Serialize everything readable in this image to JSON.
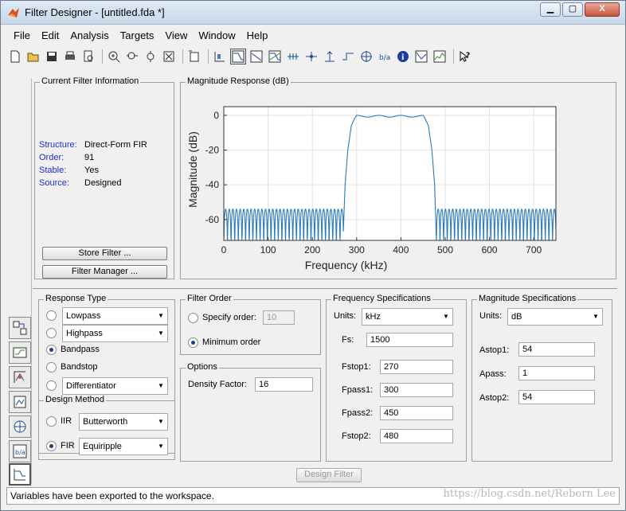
{
  "window": {
    "title": "Filter Designer -  [untitled.fda *]",
    "minimize_label": "▁",
    "maximize_label": "▢",
    "close_label": "X"
  },
  "menu": [
    {
      "label": "File"
    },
    {
      "label": "Edit"
    },
    {
      "label": "Analysis"
    },
    {
      "label": "Targets"
    },
    {
      "label": "View"
    },
    {
      "label": "Window"
    },
    {
      "label": "Help"
    }
  ],
  "current_filter": {
    "title": "Current Filter Information",
    "structure_label": "Structure:",
    "structure_value": "Direct-Form FIR",
    "order_label": "Order:",
    "order_value": "91",
    "stable_label": "Stable:",
    "stable_value": "Yes",
    "source_label": "Source:",
    "source_value": "Designed",
    "store_button": "Store Filter ...",
    "manager_button": "Filter Manager ..."
  },
  "magnitude_panel": {
    "title": "Magnitude Response (dB)"
  },
  "chart_data": {
    "type": "line",
    "title": "",
    "xlabel": "Frequency (kHz)",
    "ylabel": "Magnitude (dB)",
    "xlim": [
      0,
      750
    ],
    "ylim": [
      -72,
      5
    ],
    "xticks": [
      0,
      100,
      200,
      300,
      400,
      500,
      600,
      700
    ],
    "yticks": [
      0,
      -20,
      -40,
      -60
    ],
    "grid": true,
    "color": "#2b7bb9",
    "description_points": {
      "stopband1_end_khz": 270,
      "passband_start_khz": 300,
      "passband_end_khz": 450,
      "stopband2_start_khz": 480,
      "stopband_ripple_top_db": -54,
      "stopband_floor_db": -72,
      "passband_ripple_db": 1
    },
    "series": [
      {
        "x": [
          0,
          270,
          285,
          300,
          310,
          330,
          350,
          375,
          400,
          425,
          440,
          450,
          465,
          480,
          750
        ],
        "y": [
          -54,
          -54,
          -28,
          -1,
          0,
          -1,
          0,
          -1,
          0,
          -1,
          0,
          -1,
          -28,
          -54,
          -54
        ]
      }
    ]
  },
  "response_type": {
    "title": "Response Type",
    "lowpass": "Lowpass",
    "highpass": "Highpass",
    "bandpass": "Bandpass",
    "bandstop": "Bandstop",
    "differentiator": "Differentiator",
    "selected": "Bandpass"
  },
  "design_method": {
    "title": "Design Method",
    "iir_label": "IIR",
    "iir_value": "Butterworth",
    "fir_label": "FIR",
    "fir_value": "Equiripple",
    "selected": "FIR"
  },
  "filter_order": {
    "title": "Filter Order",
    "specify_label": "Specify order:",
    "specify_value": "10",
    "minimum_label": "Minimum order",
    "selected": "Minimum order"
  },
  "options": {
    "title": "Options",
    "density_label": "Density Factor:",
    "density_value": "16"
  },
  "freq_spec": {
    "title": "Frequency Specifications",
    "units_label": "Units:",
    "units_value": "kHz",
    "fs_label": "Fs:",
    "fs_value": "1500",
    "fstop1_label": "Fstop1:",
    "fstop1_value": "270",
    "fpass1_label": "Fpass1:",
    "fpass1_value": "300",
    "fpass2_label": "Fpass2:",
    "fpass2_value": "450",
    "fstop2_label": "Fstop2:",
    "fstop2_value": "480"
  },
  "mag_spec": {
    "title": "Magnitude Specifications",
    "units_label": "Units:",
    "units_value": "dB",
    "astop1_label": "Astop1:",
    "astop1_value": "54",
    "apass_label": "Apass:",
    "apass_value": "1",
    "astop2_label": "Astop2:",
    "astop2_value": "54"
  },
  "design_button": "Design Filter",
  "status": "Variables have been exported to the workspace.",
  "watermark": "https://blog.csdn.net/Reborn Lee"
}
